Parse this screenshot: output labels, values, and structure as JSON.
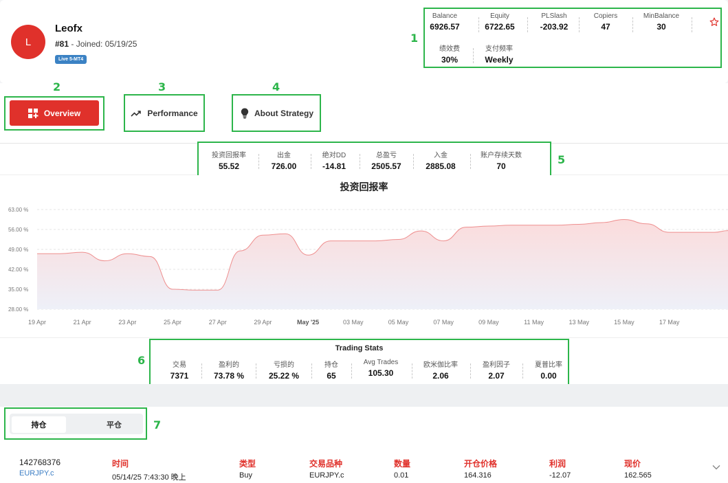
{
  "trader": {
    "initial": "L",
    "name": "Leofx",
    "rank": "#81",
    "joined": " - Joined: 05/19/25",
    "account_badge": "Live 5-MT4"
  },
  "account_stats": [
    {
      "label": "Balance",
      "value": "6926.57"
    },
    {
      "label": "Equity",
      "value": "6722.65"
    },
    {
      "label": "PLSlash",
      "value": "-203.92"
    },
    {
      "label": "Copiers",
      "value": "47"
    },
    {
      "label": "MinBalance",
      "value": "30"
    },
    {
      "label": "绩效费",
      "value": "30%"
    },
    {
      "label": "支付频率",
      "value": "Weekly"
    }
  ],
  "tabs": {
    "overview": "Overview",
    "performance": "Performance",
    "about": "About Strategy"
  },
  "summary": [
    {
      "label": "投资回报率",
      "value": "55.52"
    },
    {
      "label": "出金",
      "value": "726.00"
    },
    {
      "label": "绝对DD",
      "value": "-14.81"
    },
    {
      "label": "总盈亏",
      "value": "2505.57"
    },
    {
      "label": "入金",
      "value": "2885.08"
    },
    {
      "label": "账户存续天数",
      "value": "70"
    }
  ],
  "chart_data": {
    "type": "area",
    "title": "投资回报率",
    "xlabel": "",
    "ylabel": "",
    "x_ticks": [
      "19 Apr",
      "21 Apr",
      "23 Apr",
      "25 Apr",
      "27 Apr",
      "29 Apr",
      "May '25",
      "03 May",
      "05 May",
      "07 May",
      "09 May",
      "11 May",
      "13 May",
      "15 May",
      "17 May"
    ],
    "y_ticks": [
      "28.00 %",
      "35.00 %",
      "42.00 %",
      "49.00 %",
      "56.00 %",
      "63.00 %"
    ],
    "ylim": [
      28,
      63
    ],
    "xlim": [
      0,
      30.6
    ],
    "grid": true,
    "series": [
      {
        "values": [
          [
            0,
            47.5
          ],
          [
            1,
            47.5
          ],
          [
            2,
            48
          ],
          [
            3,
            45
          ],
          [
            4,
            47.5
          ],
          [
            5,
            46.5
          ],
          [
            6,
            35
          ],
          [
            7,
            34.7
          ],
          [
            8,
            34.7
          ],
          [
            9,
            48.5
          ],
          [
            10,
            54
          ],
          [
            11,
            54.5
          ],
          [
            12,
            47
          ],
          [
            13,
            52
          ],
          [
            14,
            52
          ],
          [
            15,
            52
          ],
          [
            16,
            52.5
          ],
          [
            17,
            55.5
          ],
          [
            18,
            52
          ],
          [
            19,
            56.8
          ],
          [
            20,
            57.2
          ],
          [
            21,
            57.5
          ],
          [
            22,
            57.5
          ],
          [
            23,
            57.5
          ],
          [
            24,
            57.8
          ],
          [
            25,
            58.4
          ],
          [
            26,
            59.5
          ],
          [
            27,
            58
          ],
          [
            28,
            55
          ],
          [
            29,
            55
          ],
          [
            30,
            55
          ],
          [
            30.6,
            55.6
          ]
        ]
      }
    ]
  },
  "trading_stats": {
    "title": "Trading Stats",
    "items": [
      {
        "label": "交易",
        "value": "7371"
      },
      {
        "label": "盈利的",
        "value": "73.78 %"
      },
      {
        "label": "亏损的",
        "value": "25.22 %"
      },
      {
        "label": "持仓",
        "value": "65"
      },
      {
        "label": "Avg Trades",
        "value": "105.30"
      },
      {
        "label": "欧米伽比率",
        "value": "2.06"
      },
      {
        "label": "盈利因子",
        "value": "2.07"
      },
      {
        "label": "夏普比率",
        "value": "0.00"
      }
    ]
  },
  "positions": {
    "tab_open": "持仓",
    "tab_closed": "平仓",
    "row": {
      "ticket": "142768376",
      "symbol_link": "EURJPY.c",
      "columns": [
        {
          "header": "时间",
          "value": "05/14/25 7:43:30 晚上"
        },
        {
          "header": "类型",
          "value": "Buy"
        },
        {
          "header": "交易品种",
          "value": "EURJPY.c"
        },
        {
          "header": "数量",
          "value": "0.01"
        },
        {
          "header": "开仓价格",
          "value": "164.316"
        },
        {
          "header": "利润",
          "value": "-12.07"
        },
        {
          "header": "现价",
          "value": "162.565"
        }
      ]
    }
  },
  "annotations": [
    "1",
    "2",
    "3",
    "4",
    "5",
    "6",
    "7"
  ],
  "colors": {
    "accent": "#e0312b",
    "annotation": "#2cb54a",
    "badge": "#3b82c4",
    "chart_fill_top": "#fbdcdc",
    "chart_fill_bottom": "#eef0f8",
    "chart_line": "#ee8e8e"
  }
}
